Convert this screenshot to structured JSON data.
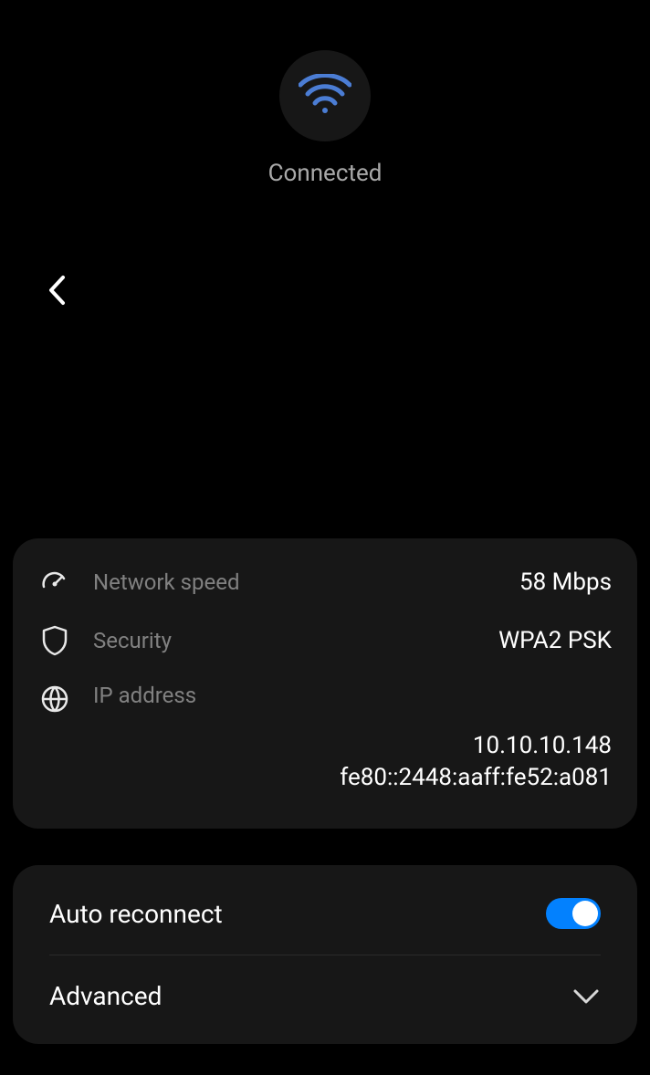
{
  "header": {
    "status": "Connected"
  },
  "info": {
    "networkSpeed": {
      "label": "Network speed",
      "value": "58 Mbps"
    },
    "security": {
      "label": "Security",
      "value": "WPA2 PSK"
    },
    "ipAddress": {
      "label": "IP address",
      "ipv4": "10.10.10.148",
      "ipv6": "fe80::2448:aaff:fe52:a081"
    }
  },
  "settings": {
    "autoReconnect": {
      "label": "Auto reconnect",
      "enabled": true
    },
    "advanced": {
      "label": "Advanced"
    }
  }
}
